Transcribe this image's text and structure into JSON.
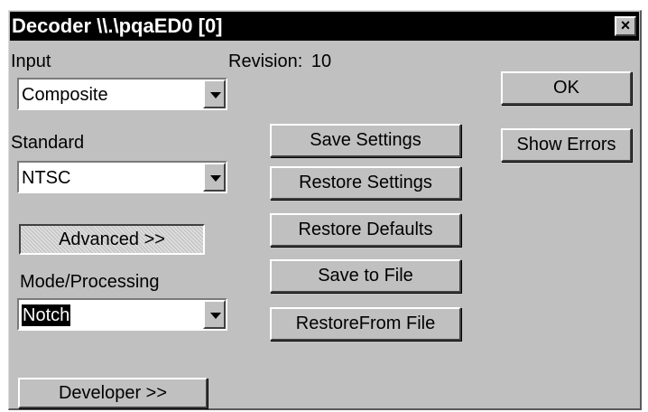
{
  "window": {
    "title": "Decoder \\\\.\\pqaED0 [0]",
    "close_glyph": "×"
  },
  "input": {
    "label": "Input",
    "value": "Composite"
  },
  "revision": {
    "label": "Revision:",
    "value": "10"
  },
  "standard": {
    "label": "Standard",
    "value": "NTSC"
  },
  "advanced_button": "Advanced >>",
  "mode_processing": {
    "label": "Mode/Processing",
    "value": "Notch"
  },
  "developer_button": "Developer >>",
  "middle_buttons": {
    "save_settings": "Save Settings",
    "restore_settings": "Restore Settings",
    "restore_defaults": "Restore Defaults",
    "save_to_file": "Save to File",
    "restore_from_file": "RestoreFrom File"
  },
  "right_buttons": {
    "ok": "OK",
    "show_errors": "Show Errors"
  },
  "colors": {
    "titlebar": "#000000",
    "dialog_face": "#c0c0c0",
    "selection": "#000000"
  }
}
